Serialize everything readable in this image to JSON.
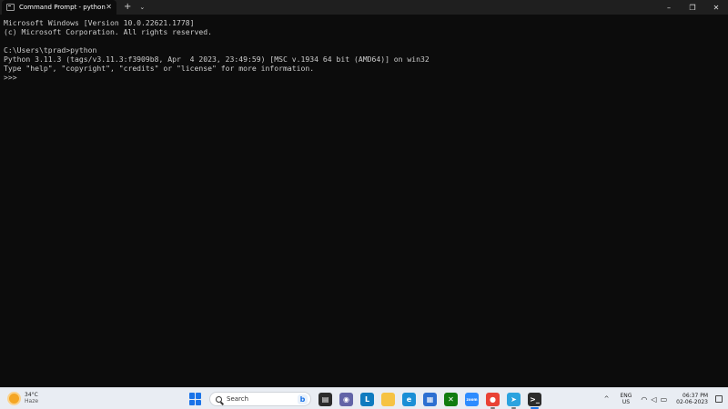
{
  "window": {
    "tab_title": "Command Prompt - python",
    "tab_close": "✕",
    "new_tab": "+",
    "tab_dropdown": "⌄",
    "minimize": "–",
    "maximize": "❐",
    "close": "✕"
  },
  "terminal": {
    "lines": [
      "Microsoft Windows [Version 10.0.22621.1778]",
      "(c) Microsoft Corporation. All rights reserved.",
      "",
      "C:\\Users\\tprad>python",
      "Python 3.11.3 (tags/v3.11.3:f3909b8, Apr  4 2023, 23:49:59) [MSC v.1934 64 bit (AMD64)] on win32",
      "Type \"help\", \"copyright\", \"credits\" or \"license\" for more information.",
      ">>>"
    ]
  },
  "taskbar": {
    "weather_temp": "34°C",
    "weather_cond": "Haze",
    "search_label": "Search",
    "apps": [
      {
        "icon": "file-explorer-icon",
        "glyph": "▤",
        "bg": "#2b2b2b"
      },
      {
        "icon": "teams-chat-icon",
        "glyph": "◉",
        "bg": "#6264a7"
      },
      {
        "icon": "l-app-icon",
        "glyph": "L",
        "bg": "#0f7bbf"
      },
      {
        "icon": "folder-icon",
        "glyph": "",
        "bg": "#f6c343"
      },
      {
        "icon": "edge-icon",
        "glyph": "e",
        "bg": "#1a8fd6"
      },
      {
        "icon": "store-icon",
        "glyph": "▦",
        "bg": "#2c6fd1"
      },
      {
        "icon": "xbox-icon",
        "glyph": "✕",
        "bg": "#107c10"
      },
      {
        "icon": "zoom-icon",
        "glyph": "zoom",
        "bg": "#2d8cff"
      },
      {
        "icon": "chrome-icon",
        "glyph": "●",
        "bg": "#e94235"
      },
      {
        "icon": "telegram-icon",
        "glyph": "➤",
        "bg": "#2aa3df"
      },
      {
        "icon": "terminal-icon",
        "glyph": ">_",
        "bg": "#2b2b2b"
      }
    ],
    "tray_chevron": "^",
    "lang_primary": "ENG",
    "lang_secondary": "US",
    "wifi": "📶",
    "volume": "🔊",
    "battery": "▭",
    "time": "06:37 PM",
    "date": "02-06-2023"
  },
  "colors": {
    "terminal_bg": "#0c0c0c",
    "terminal_fg": "#cccccc",
    "taskbar_bg": "#e9edf3",
    "accent": "#1a73e8"
  }
}
